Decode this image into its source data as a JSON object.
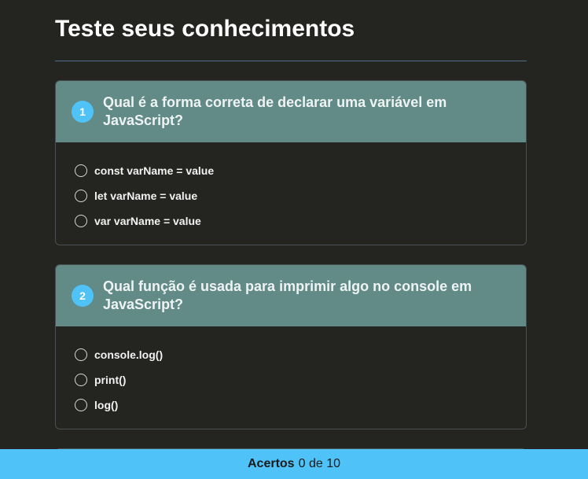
{
  "page": {
    "title": "Teste seus conhecimentos"
  },
  "questions": [
    {
      "number": "1",
      "text": "Qual é a forma correta de declarar uma variável em JavaScript?",
      "options": [
        "const varName = value",
        "let varName = value",
        "var varName = value"
      ]
    },
    {
      "number": "2",
      "text": "Qual função é usada para imprimir algo no console em JavaScript?",
      "options": [
        "console.log()",
        "print()",
        "log()"
      ]
    }
  ],
  "footer": {
    "label": "Acertos",
    "score": "0",
    "separator": "de",
    "total": "10"
  },
  "colors": {
    "background": "#242421",
    "card_header": "#628b88",
    "accent": "#4fc3f7",
    "divider": "#4f6f8d"
  }
}
